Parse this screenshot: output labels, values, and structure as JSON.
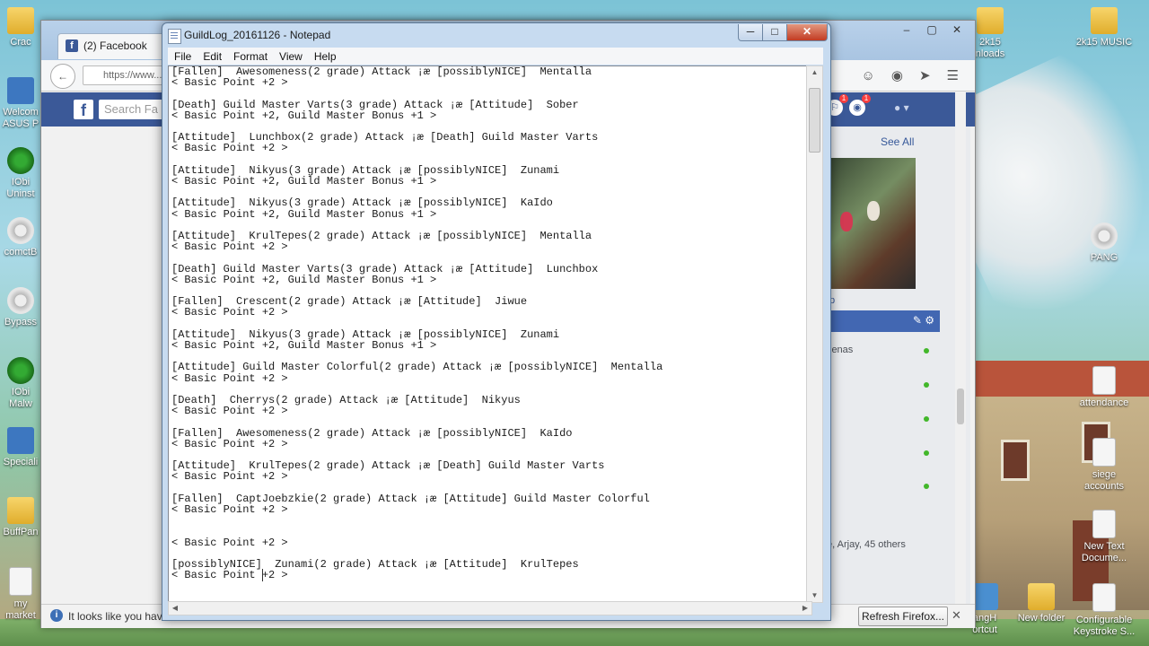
{
  "desktop": {
    "icons_left": [
      {
        "label": "Crac",
        "type": "folder"
      },
      {
        "label": "Welcom\nASUS P",
        "type": "app"
      },
      {
        "label": "IObi\nUninst",
        "type": "greenapp"
      },
      {
        "label": "comctB",
        "type": "gear"
      },
      {
        "label": "Bypass",
        "type": "gear"
      },
      {
        "label": "IObi\nMalw",
        "type": "greenapp"
      },
      {
        "label": "Speciali",
        "type": "app"
      },
      {
        "label": "BuffPan",
        "type": "folder"
      },
      {
        "label": "my\nmarket",
        "type": "file"
      }
    ],
    "icons_right": [
      {
        "label": "2k15\nnloads",
        "type": "folder"
      },
      {
        "label": "2k15 MUSIC",
        "type": "folder"
      },
      {
        "label": "PANG",
        "type": "gear"
      },
      {
        "label": "attendance",
        "type": "file"
      },
      {
        "label": "siege\naccounts",
        "type": "file"
      },
      {
        "label": "New Text\nDocume...",
        "type": "file"
      },
      {
        "label": "angH\nortcut",
        "type": "app"
      },
      {
        "label": "New folder",
        "type": "folder"
      },
      {
        "label": "Configurable\nKeystroke S...",
        "type": "file"
      }
    ]
  },
  "firefox": {
    "tab_label": "(2) Facebook",
    "url_text": "https://www...",
    "search_placeholder": "Search Fa",
    "see_all": "See All",
    "chat_name_fragment": "lenas",
    "likes_text": "e, Arjay, 45 others",
    "photo_caption": "p",
    "status_message": "It looks like you have",
    "refresh_button": "Refresh Firefox...",
    "close_x": "✕",
    "badges": [
      "1",
      "1"
    ]
  },
  "notepad": {
    "title": "GuildLog_20161126 - Notepad",
    "menu": [
      "File",
      "Edit",
      "Format",
      "View",
      "Help"
    ],
    "entries": [
      {
        "line1": "[Fallen]  Awesomeness(2 grade) Attack ¡æ [possiblyNICE]  Mentalla",
        "line2": "< Basic Point +2 >"
      },
      {
        "line1": "[Death] Guild Master Varts(3 grade) Attack ¡æ [Attitude]  Sober",
        "line2": "< Basic Point +2, Guild Master Bonus +1 >"
      },
      {
        "line1": "[Attitude]  Lunchbox(2 grade) Attack ¡æ [Death] Guild Master Varts",
        "line2": "< Basic Point +2 >"
      },
      {
        "line1": "[Attitude]  Nikyus(3 grade) Attack ¡æ [possiblyNICE]  Zunami",
        "line2": "< Basic Point +2, Guild Master Bonus +1 >"
      },
      {
        "line1": "[Attitude]  Nikyus(3 grade) Attack ¡æ [possiblyNICE]  KaIdo",
        "line2": "< Basic Point +2, Guild Master Bonus +1 >"
      },
      {
        "line1": "[Attitude]  KrulTepes(2 grade) Attack ¡æ [possiblyNICE]  Mentalla",
        "line2": "< Basic Point +2 >"
      },
      {
        "line1": "[Death] Guild Master Varts(3 grade) Attack ¡æ [Attitude]  Lunchbox",
        "line2": "< Basic Point +2, Guild Master Bonus +1 >"
      },
      {
        "line1": "[Fallen]  Crescent(2 grade) Attack ¡æ [Attitude]  Jiwue",
        "line2": "< Basic Point +2 >"
      },
      {
        "line1": "[Attitude]  Nikyus(3 grade) Attack ¡æ [possiblyNICE]  Zunami",
        "line2": "< Basic Point +2, Guild Master Bonus +1 >"
      },
      {
        "line1": "[Attitude] Guild Master Colorful(2 grade) Attack ¡æ [possiblyNICE]  Mentalla",
        "line2": "< Basic Point +2 >"
      },
      {
        "line1": "[Death]  Cherrys(2 grade) Attack ¡æ [Attitude]  Nikyus",
        "line2": "< Basic Point +2 >"
      },
      {
        "line1": "[Fallen]  Awesomeness(2 grade) Attack ¡æ [possiblyNICE]  KaIdo",
        "line2": "< Basic Point +2 >"
      },
      {
        "line1": "[Attitude]  KrulTepes(2 grade) Attack ¡æ [Death] Guild Master Varts",
        "line2": "< Basic Point +2 >"
      },
      {
        "line1": "[Fallen]  CaptJoebzkie(2 grade) Attack ¡æ [Attitude] Guild Master Colorful",
        "line2": "< Basic Point +2 >"
      },
      {
        "line1": "",
        "line2": "< Basic Point +2 >"
      },
      {
        "line1": "[possiblyNICE]  Zunami(2 grade) Attack ¡æ [Attitude]  KrulTepes",
        "line2": "< Basic Point +2 >"
      }
    ]
  }
}
